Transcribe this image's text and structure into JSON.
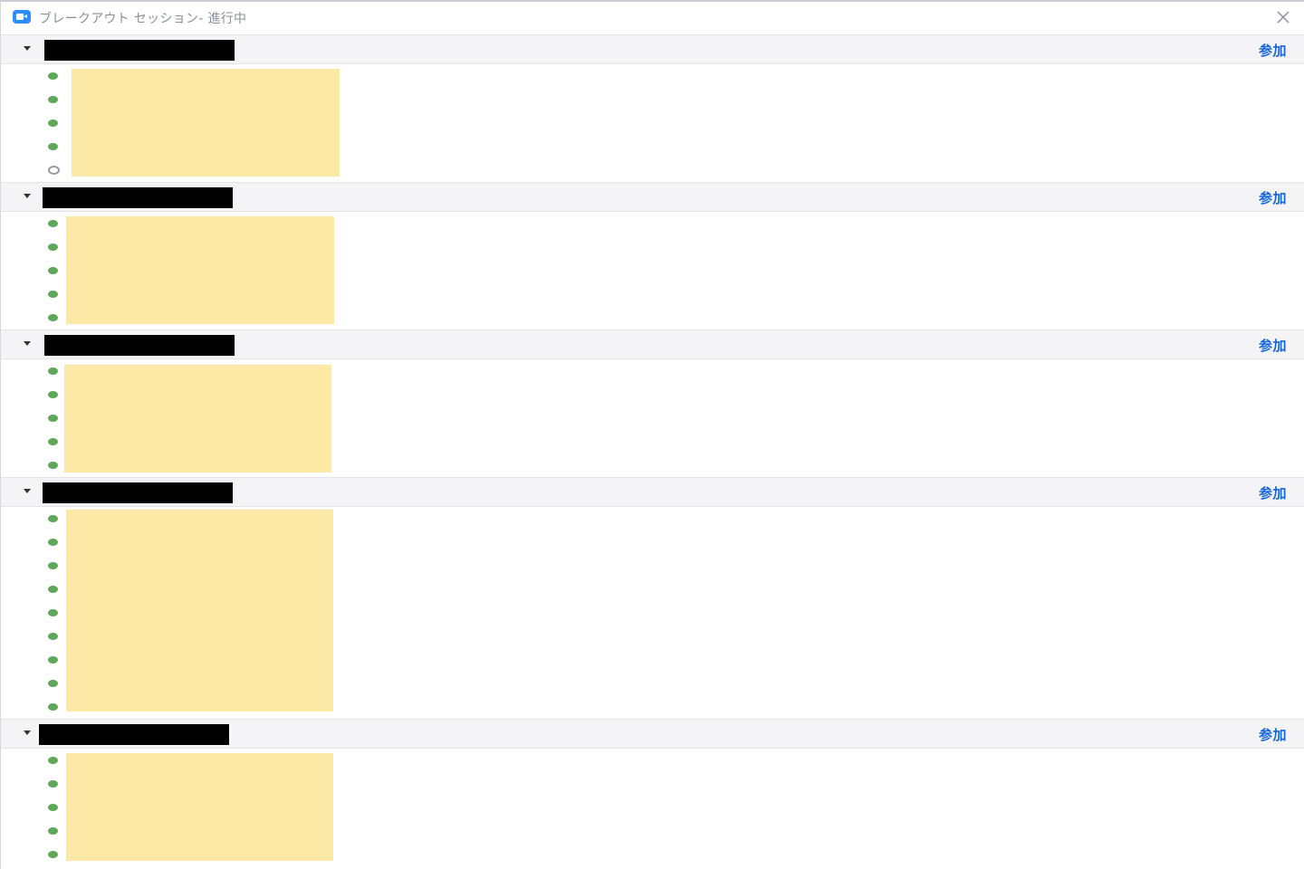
{
  "window": {
    "title": "ブレークアウト セッション- 進行中",
    "app_icon": "zoom-camera-icon",
    "close_icon": "close-icon"
  },
  "rooms": [
    {
      "name": "",
      "join_label": "参加",
      "participants": [
        {
          "name": "",
          "status": "active"
        },
        {
          "name": "",
          "status": "active"
        },
        {
          "name": "",
          "status": "active"
        },
        {
          "name": "",
          "status": "active"
        },
        {
          "name": "",
          "status": "away"
        }
      ]
    },
    {
      "name": "",
      "join_label": "参加",
      "participants": [
        {
          "name": "",
          "status": "active"
        },
        {
          "name": "",
          "status": "active"
        },
        {
          "name": "",
          "status": "active"
        },
        {
          "name": "",
          "status": "active"
        },
        {
          "name": "",
          "status": "active"
        }
      ]
    },
    {
      "name": "",
      "join_label": "参加",
      "participants": [
        {
          "name": "",
          "status": "active"
        },
        {
          "name": "",
          "status": "active"
        },
        {
          "name": "",
          "status": "active"
        },
        {
          "name": "",
          "status": "active"
        },
        {
          "name": "",
          "status": "active"
        }
      ]
    },
    {
      "name": "",
      "join_label": "参加",
      "participants": [
        {
          "name": "",
          "status": "active"
        },
        {
          "name": "",
          "status": "active"
        },
        {
          "name": "",
          "status": "active"
        },
        {
          "name": "",
          "status": "active"
        },
        {
          "name": "",
          "status": "active"
        },
        {
          "name": "",
          "status": "active"
        },
        {
          "name": "",
          "status": "active"
        },
        {
          "name": "",
          "status": "active"
        },
        {
          "name": "",
          "status": "active"
        }
      ]
    },
    {
      "name": "",
      "join_label": "参加",
      "participants": [
        {
          "name": "",
          "status": "active"
        },
        {
          "name": "",
          "status": "active"
        },
        {
          "name": "",
          "status": "active"
        },
        {
          "name": "",
          "status": "active"
        },
        {
          "name": "",
          "status": "active"
        }
      ]
    }
  ],
  "colors": {
    "accent": "#1565d8",
    "active_status": "#5fa85a",
    "away_status": "#9a9a9a",
    "redaction_name": "#000000",
    "redaction_participants": "#fde9a6",
    "header_bg": "#f4f4f6"
  }
}
